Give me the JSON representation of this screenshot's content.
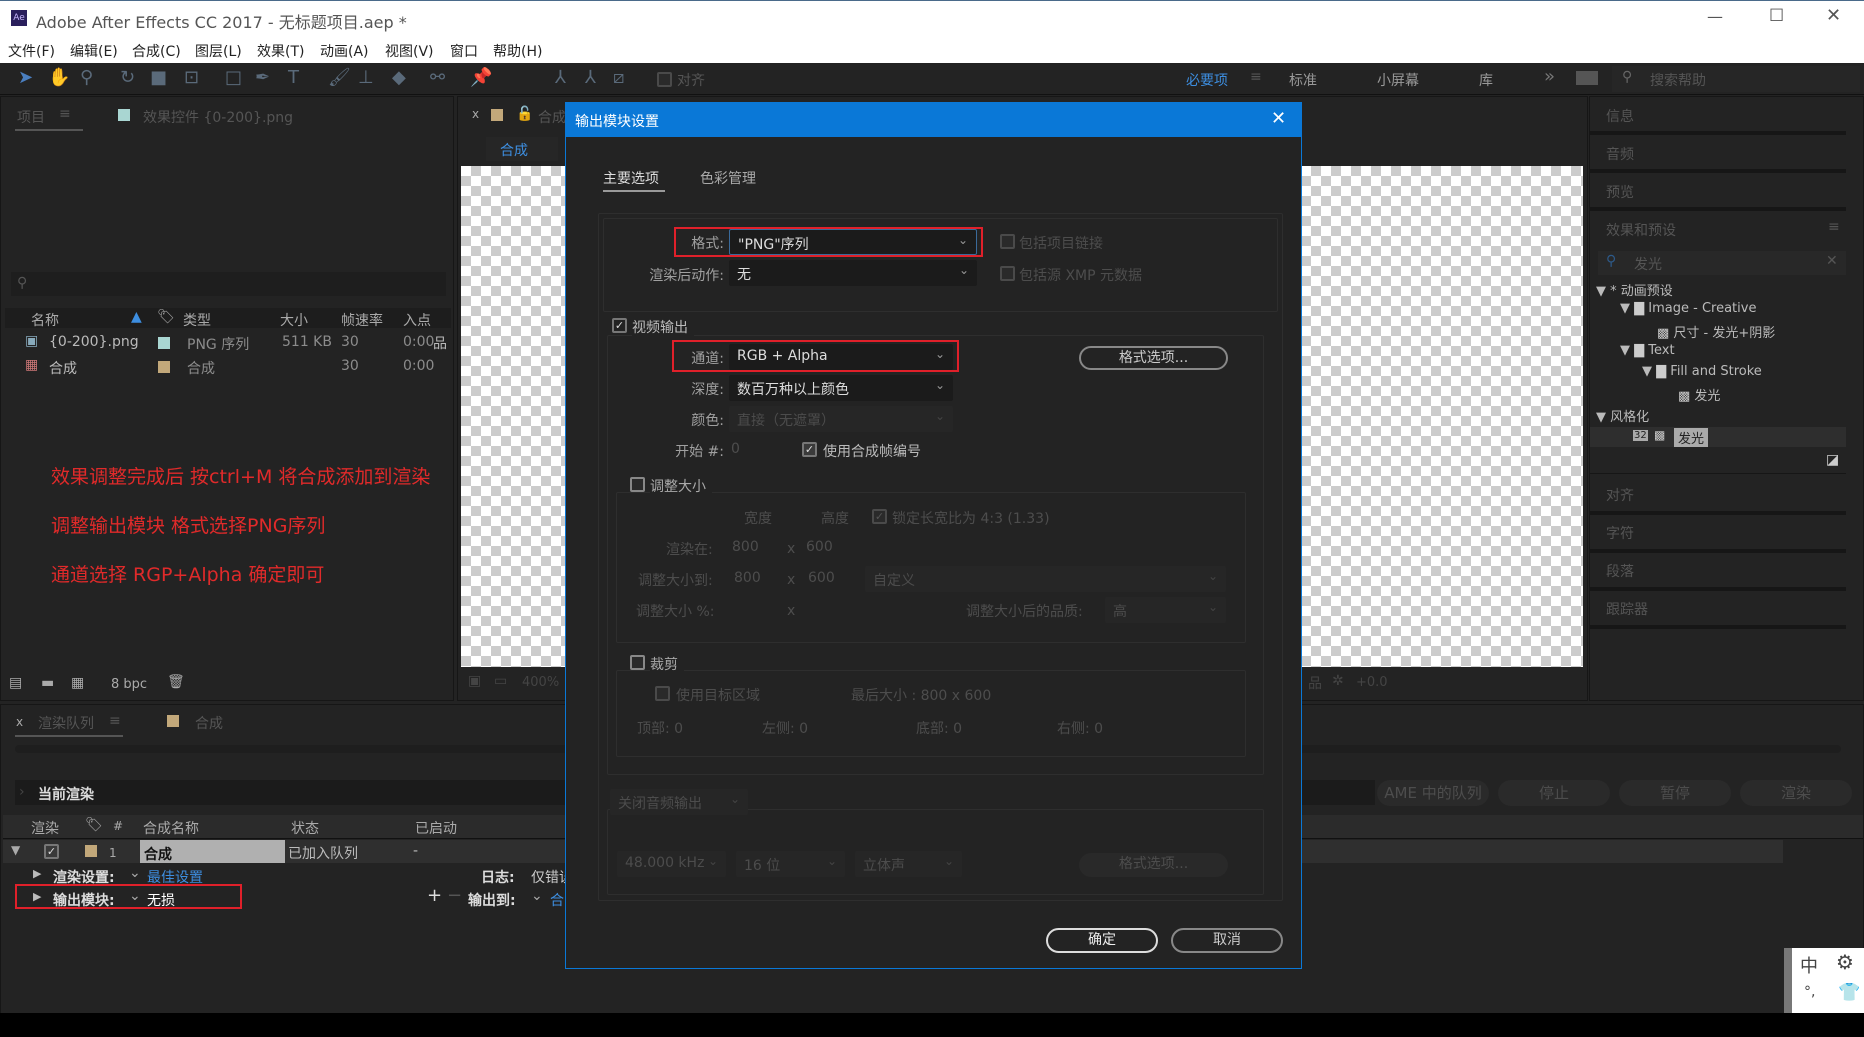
{
  "window": {
    "title": "Adobe After Effects CC 2017 - 无标题项目.aep *",
    "app_icon": "Ae"
  },
  "menu": [
    "文件(F)",
    "编辑(E)",
    "合成(C)",
    "图层(L)",
    "效果(T)",
    "动画(A)",
    "视图(V)",
    "窗口",
    "帮助(H)"
  ],
  "toolbar": {
    "align_label": "对齐"
  },
  "workspaces": {
    "items": [
      "必要项",
      "标准",
      "小屏幕",
      "库"
    ],
    "active": "必要项",
    "more": "»",
    "search_placeholder": "搜索帮助"
  },
  "project": {
    "tab": "项目",
    "effects_tab": "效果控件 {0-200}.png",
    "columns": [
      "名称",
      "类型",
      "大小",
      "帧速率",
      "入点"
    ],
    "rows": [
      {
        "name": "{0-200}.png",
        "type": "PNG 序列",
        "size": "511 KB",
        "fps": "30",
        "in": "0:00",
        "swatch": "#a9d6d2"
      },
      {
        "name": "合成",
        "type": "合成",
        "size": "",
        "fps": "30",
        "in": "0:00",
        "swatch": "#c2a87a"
      }
    ],
    "bpc": "8 bpc"
  },
  "annotations": [
    "效果调整完成后 按ctrl+M 将合成添加到渲染",
    "调整输出模块 格式选择PNG序列",
    "通道选择 RGP+Alpha 确定即可"
  ],
  "composition": {
    "tab": "合成",
    "subtab": "合成",
    "zoom": "400%",
    "exposure": "+0.0"
  },
  "right_panel": {
    "panels": [
      "信息",
      "音频",
      "预览",
      "效果和预设"
    ],
    "search_value": "发光",
    "tree": [
      {
        "label": "* 动画预设",
        "level": 0,
        "kind": "group"
      },
      {
        "label": "Image - Creative",
        "level": 1,
        "kind": "folder"
      },
      {
        "label": "尺寸 - 发光+阴影",
        "level": 2,
        "kind": "preset"
      },
      {
        "label": "Text",
        "level": 1,
        "kind": "folder"
      },
      {
        "label": "Fill and Stroke",
        "level": 2,
        "kind": "folder"
      },
      {
        "label": "发光",
        "level": 3,
        "kind": "preset"
      },
      {
        "label": "风格化",
        "level": 0,
        "kind": "group"
      },
      {
        "label": "发光",
        "level": 1,
        "kind": "effect",
        "badge": "32"
      }
    ],
    "bottom_panels": [
      "对齐",
      "字符",
      "段落",
      "跟踪器"
    ]
  },
  "render_queue": {
    "tab": "渲染队列",
    "comp_tab": "合成",
    "current_render": "当前渲染",
    "buttons": [
      "AME 中的队列",
      "停止",
      "暂停",
      "渲染"
    ],
    "columns": [
      "渲染",
      "#",
      "合成名称",
      "状态",
      "已启动"
    ],
    "item": {
      "index": "1",
      "comp": "合成",
      "status": "已加入队列",
      "started": "-"
    },
    "render_settings_label": "渲染设置:",
    "render_settings_value": "最佳设置",
    "log_label": "日志:",
    "log_value": "仅错误",
    "output_module_label": "输出模块:",
    "output_module_value": "无损",
    "output_to_label": "输出到:",
    "output_to_value": "合"
  },
  "dialog": {
    "title": "输出模块设置",
    "tabs": [
      "主要选项",
      "色彩管理"
    ],
    "active_tab": "主要选项",
    "format_label": "格式:",
    "format_value": "\"PNG\"序列",
    "include_project_link": "包括项目链接",
    "post_render_label": "渲染后动作:",
    "post_render_value": "无",
    "include_xmp": "包括源 XMP 元数据",
    "video_output": "视频输出",
    "video_output_checked": true,
    "channels_label": "通道:",
    "channels_value": "RGB + Alpha",
    "format_options": "格式选项...",
    "depth_label": "深度:",
    "depth_value": "数百万种以上颜色",
    "color_label": "颜色:",
    "color_value": "直接（无遮罩）",
    "start_label": "开始 #:",
    "start_value": "0",
    "use_comp_frame": "使用合成帧编号",
    "use_comp_frame_checked": true,
    "resize": "调整大小",
    "width_label": "宽度",
    "height_label": "高度",
    "lock_aspect": "锁定长宽比为 4:3 (1.33)",
    "render_at_label": "渲染在:",
    "render_at_w": "800",
    "render_at_h": "600",
    "resize_to_label": "调整大小到:",
    "resize_to_w": "800",
    "resize_to_h": "600",
    "resize_preset": "自定义",
    "resize_pct_label": "调整大小 %:",
    "x": "x",
    "quality_label": "调整大小后的品质:",
    "quality_value": "高",
    "crop": "裁剪",
    "use_roi": "使用目标区域",
    "final_size": "最后大小 : 800 x 600",
    "top": "顶部: 0",
    "left": "左侧: 0",
    "bottom": "底部: 0",
    "right": "右侧: 0",
    "audio_output": "关闭音频输出",
    "sample_rate": "48.000 kHz",
    "bit_depth": "16 位",
    "channels": "立体声",
    "audio_format_options": "格式选项...",
    "ok": "确定",
    "cancel": "取消"
  },
  "colors": {
    "dialog_header": "#0a78d7",
    "highlight_red": "#e0202a",
    "link_blue": "#3d8ee0"
  }
}
